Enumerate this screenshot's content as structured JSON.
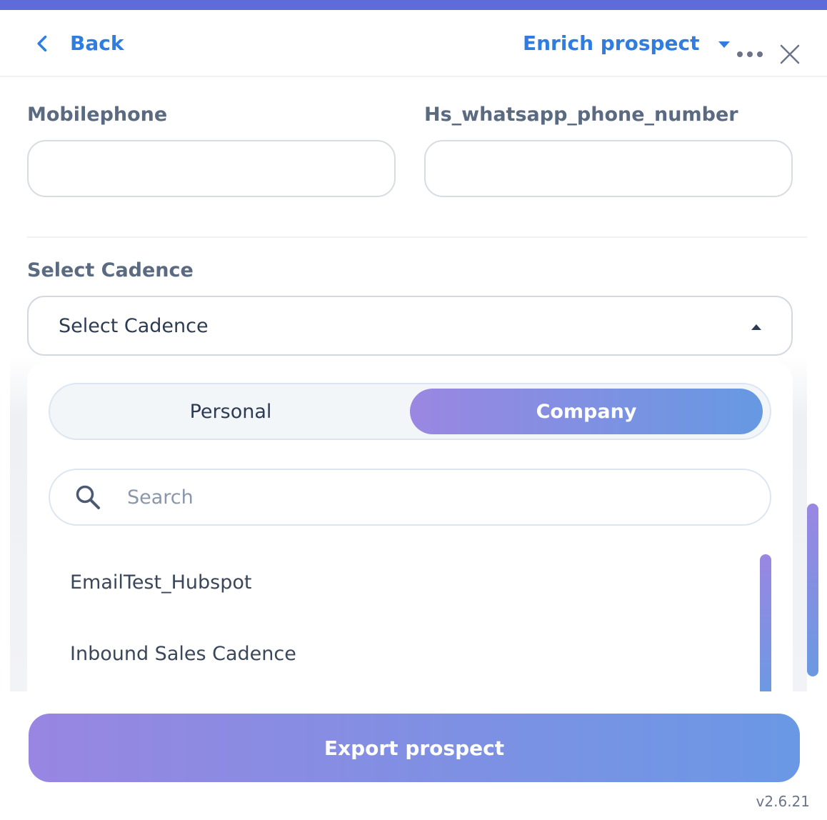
{
  "header": {
    "back_label": "Back",
    "enrich_label": "Enrich prospect"
  },
  "fields": {
    "mobilephone_label": "Mobilephone",
    "mobilephone_value": "",
    "whatsapp_label": "Hs_whatsapp_phone_number",
    "whatsapp_value": ""
  },
  "cadence": {
    "section_label": "Select Cadence",
    "selected_value": "Select Cadence",
    "tabs": [
      {
        "label": "Personal",
        "active": false
      },
      {
        "label": "Company",
        "active": true
      }
    ],
    "search_placeholder": "Search",
    "items": [
      "EmailTest_Hubspot",
      "Inbound Sales Cadence"
    ]
  },
  "footer": {
    "export_label": "Export prospect",
    "version": "v2.6.21"
  },
  "colors": {
    "accent_blue": "#2f7de1",
    "top_bar": "#5f6bd8",
    "gradient_start": "#9886e2",
    "gradient_end": "#6a98e4"
  }
}
